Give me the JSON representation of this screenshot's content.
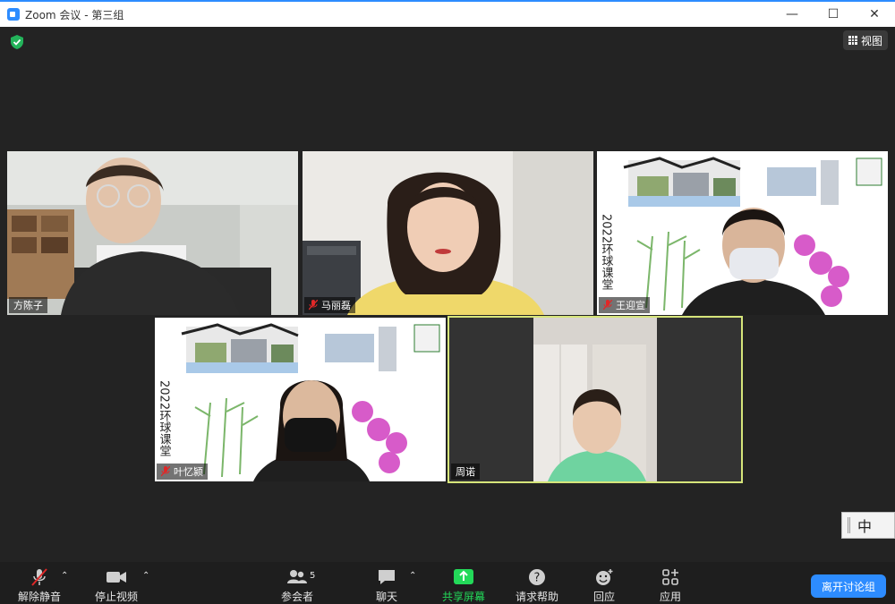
{
  "window": {
    "title": "Zoom 会议 - 第三组",
    "minimize": "—",
    "maximize": "☐",
    "close": "✕"
  },
  "top": {
    "view_label": "视图"
  },
  "participants": [
    {
      "name": "方陈子",
      "muted": false
    },
    {
      "name": "马丽磊",
      "muted": true
    },
    {
      "name": "王迎宣",
      "muted": true
    },
    {
      "name": "叶忆颍",
      "muted": true
    },
    {
      "name": "周诺",
      "muted": false,
      "active_speaker": true
    }
  ],
  "background_text": "2022环球课堂",
  "ime": {
    "label": "中"
  },
  "toolbar": {
    "mute_label": "解除静音",
    "video_label": "停止视频",
    "participants_label": "参会者",
    "participants_count": "5",
    "chat_label": "聊天",
    "share_label": "共享屏幕",
    "help_label": "请求帮助",
    "reactions_label": "回应",
    "apps_label": "应用",
    "leave_label": "离开讨论组"
  },
  "colors": {
    "accent": "#2d8cff",
    "share_green": "#23d959",
    "active_border": "#d6e57a",
    "mute_red": "#e02828"
  }
}
